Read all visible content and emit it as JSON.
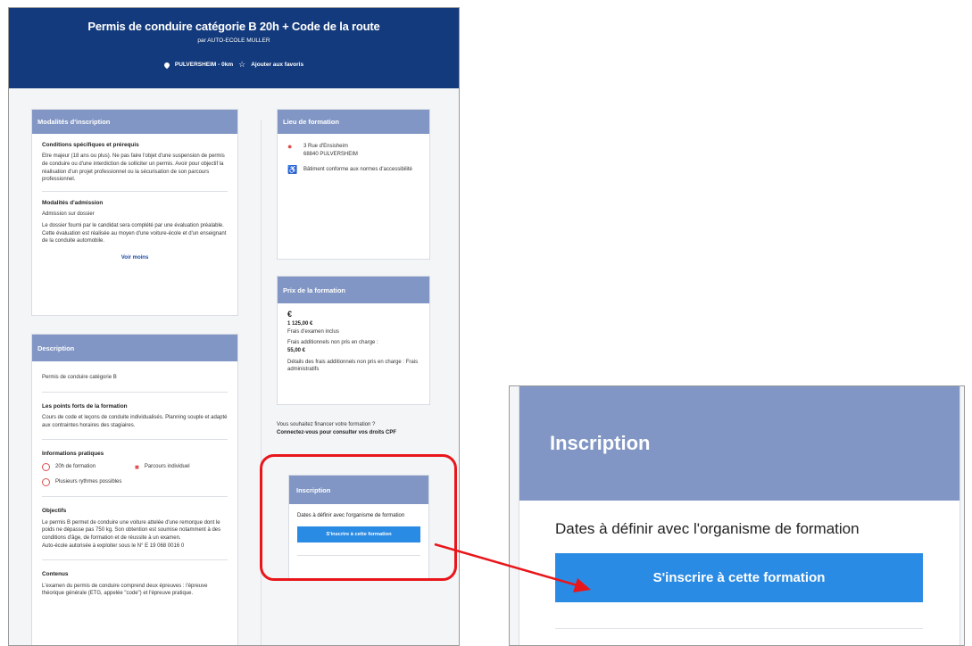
{
  "hero": {
    "title": "Permis de conduire catégorie B 20h + Code de la route",
    "subtitle": "par AUTO-ECOLE MULLER",
    "location": "PULVERSHEIM - 0km",
    "favorite": "Ajouter aux favoris"
  },
  "modalites": {
    "header": "Modalités d'inscription",
    "cond_title": "Conditions spécifiques et prérequis",
    "cond_text": "Etre majeur (18 ans ou plus). Ne pas faire l'objet d'une suspension de permis de conduire ou d'une interdiction de solliciter un permis. Avoir pour objectif la réalisation d'un projet professionnel ou la sécurisation de son parcours professionnel.",
    "adm_title": "Modalités d'admission",
    "adm_text1": "Admission sur dossier",
    "adm_text2": "Le dossier fourni par le candidat sera complété par une évaluation préalable. Cette évaluation est réalisée au moyen d'une voiture-école et d'un enseignant de la conduite automobile.",
    "voir_moins": "Voir moins"
  },
  "description": {
    "header": "Description",
    "intro": "Permis de conduire catégorie B",
    "points_title": "Les points forts de la formation",
    "points_text": "Cours de code et leçons de conduite individualisés. Planning souple et adapté aux contraintes horaires des stagiaires.",
    "info_title": "Informations pratiques",
    "info_hours": "20h de formation",
    "info_parcours": "Parcours individuel",
    "info_rythmes": "Plusieurs rythmes possibles",
    "obj_title": "Objectifs",
    "obj_text": "Le permis B permet de conduire une voiture attelée d'une remorque dont le poids ne dépasse pas 750 kg. Son obtention est soumise notamment à des conditions d'âge, de formation et de réussite à un examen.",
    "obj_text2": "Auto-école autorisée à exploiter sous le N° E 19 068 0016 0",
    "contenus_title": "Contenus",
    "contenus_text": "L'examen du permis de conduire comprend deux épreuves : l'épreuve théorique générale (ETG, appelée \"code\") et l'épreuve pratique."
  },
  "lieu": {
    "header": "Lieu de formation",
    "address1": "3 Rue d'Ensisheim",
    "address2": "68840 PULVERSHEIM",
    "access": "Bâtiment conforme aux normes d'accessibilité"
  },
  "prix": {
    "header": "Prix de la formation",
    "currency": "€",
    "amount": "1 125,00 €",
    "exam": "Frais d'examen inclus",
    "extra_label": "Frais additionnels non pris en charge :",
    "extra_amount": "55,00 €",
    "detail": "Détails des frais additionnels non pris en charge : Frais administratifs"
  },
  "cpf": {
    "question": "Vous souhaitez financer votre formation ?",
    "link": "Connectez-vous pour consulter vos droits CPF"
  },
  "inscription": {
    "header": "Inscription",
    "dates": "Dates à définir avec l'organisme de formation",
    "button": "S'inscrire à cette formation"
  },
  "zoom": {
    "header": "Inscription",
    "dates": "Dates à définir avec l'organisme de formation",
    "button": "S'inscrire à cette formation"
  },
  "colors": {
    "hero": "#133a7c",
    "card_header": "#8196c4",
    "button": "#2a8be4",
    "highlight": "#e8161b"
  }
}
